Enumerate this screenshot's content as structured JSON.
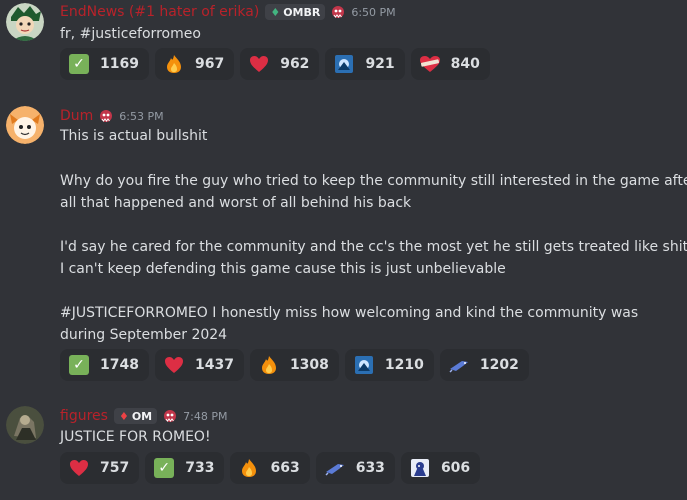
{
  "messages": [
    {
      "username": "EndNews (#1 hater of erika)",
      "tag": "OMBR",
      "timestamp": "6:50 PM",
      "lines": [
        "fr, #justiceforromeo"
      ],
      "reactions": [
        {
          "icon": "check-emoji",
          "count": "1169"
        },
        {
          "icon": "fire-emoji",
          "count": "967"
        },
        {
          "icon": "heart-emoji",
          "count": "962"
        },
        {
          "icon": "custom-blue-emoji",
          "count": "921"
        },
        {
          "icon": "heart-with-bandage-emoji",
          "count": "840"
        }
      ]
    },
    {
      "username": "Dum",
      "timestamp": "6:53 PM",
      "lines": [
        "This is actual bullshit",
        "",
        "Why do you fire the guy who tried to keep the community still interested in the game after",
        "all that happened and worst of all behind his back",
        "",
        "I'd say he cared for the community and the cc's the most yet he still gets treated like shit,",
        "I can't keep defending this game cause this is just unbelievable",
        "",
        "#JUSTICEFORROMEO I honestly miss how welcoming and kind the community was",
        "during September 2024"
      ],
      "reactions": [
        {
          "icon": "check-emoji",
          "count": "1748"
        },
        {
          "icon": "heart-emoji",
          "count": "1437"
        },
        {
          "icon": "fire-emoji",
          "count": "1308"
        },
        {
          "icon": "custom-blue-emoji",
          "count": "1210"
        },
        {
          "icon": "custom-bird-emoji",
          "count": "1202"
        }
      ]
    },
    {
      "username": "figures",
      "tag": "OM",
      "timestamp": "7:48 PM",
      "lines": [
        "JUSTICE FOR ROMEO!"
      ],
      "reactions": [
        {
          "icon": "heart-emoji",
          "count": "757"
        },
        {
          "icon": "check-emoji",
          "count": "733"
        },
        {
          "icon": "fire-emoji",
          "count": "663"
        },
        {
          "icon": "custom-bird-emoji",
          "count": "633"
        },
        {
          "icon": "custom-character-emoji",
          "count": "606"
        }
      ]
    }
  ]
}
